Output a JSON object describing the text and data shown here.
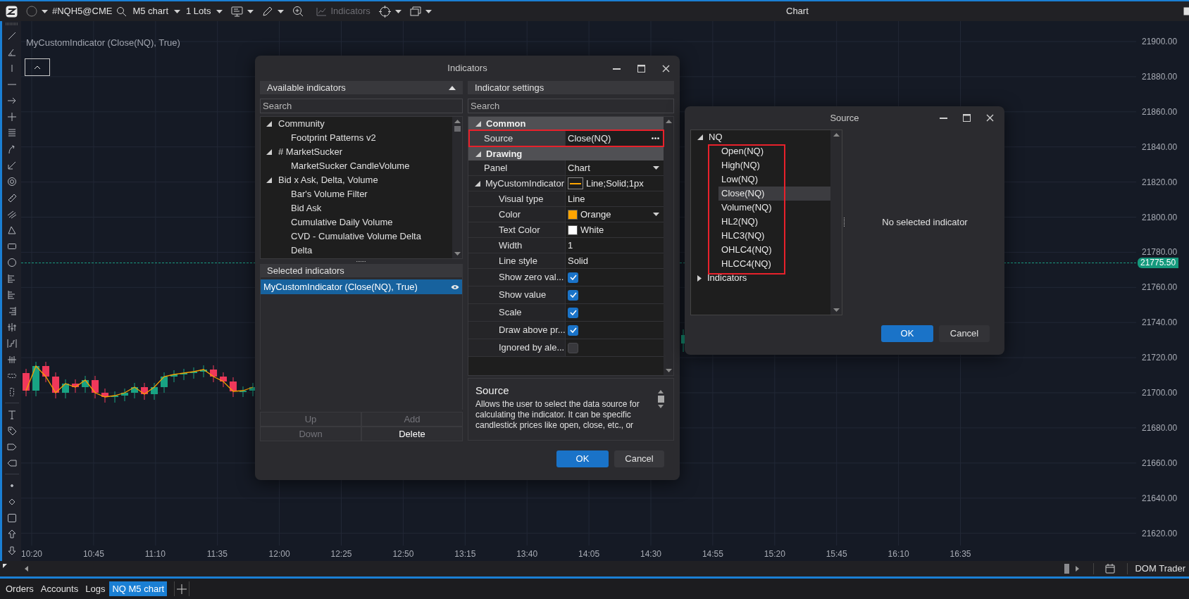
{
  "toolbar": {
    "symbol": "#NQH5@CME",
    "chart_type": "M5 chart",
    "lots": "1 Lots",
    "indicators": {
      "label": "Indicators",
      "disabled": true
    }
  },
  "window_title": "Chart",
  "chart": {
    "legend": "MyCustomIndicator (Close(NQ), True)",
    "price_labels": [
      "21900.00",
      "21880.00",
      "21860.00",
      "21840.00",
      "21820.00",
      "21800.00",
      "21780.00",
      "21760.00",
      "21740.00",
      "21720.00",
      "21700.00",
      "21680.00",
      "21660.00",
      "21640.00",
      "21620.00"
    ],
    "current_price": "21775.50",
    "time_labels": [
      "10:20",
      "10:45",
      "11:10",
      "11:35",
      "12:00",
      "12:25",
      "12:50",
      "13:15",
      "13:40",
      "14:05",
      "14:30",
      "14:55",
      "15:20",
      "15:45",
      "16:10",
      "16:35"
    ]
  },
  "indicators_dialog": {
    "title": "Indicators",
    "available": {
      "header": "Available indicators",
      "search_placeholder": "Search",
      "tree": [
        {
          "label": "Community",
          "expanded": true,
          "children": [
            {
              "label": "Footprint Patterns v2"
            }
          ]
        },
        {
          "label": "# MarketSucker",
          "expanded": true,
          "children": [
            {
              "label": "MarketSucker CandleVolume"
            }
          ]
        },
        {
          "label": "Bid x Ask, Delta, Volume",
          "expanded": true,
          "children": [
            {
              "label": "Bar's Volume Filter"
            },
            {
              "label": "Bid Ask"
            },
            {
              "label": "Cumulative Daily Volume"
            },
            {
              "label": "CVD - Cumulative Volume Delta"
            },
            {
              "label": "Delta"
            }
          ]
        }
      ]
    },
    "selected": {
      "header": "Selected indicators",
      "items": [
        {
          "label": "MyCustomIndicator (Close(NQ), True)",
          "selected": true
        }
      ]
    },
    "list_buttons": [
      {
        "label": "Up",
        "disabled": true
      },
      {
        "label": "Add",
        "disabled": true
      },
      {
        "label": "Down",
        "disabled": true
      },
      {
        "label": "Delete",
        "disabled": false
      }
    ],
    "settings": {
      "header": "Indicator settings",
      "search_placeholder": "Search",
      "categories": [
        {
          "label": "Common",
          "expanded": true,
          "properties": [
            {
              "name": "Source",
              "kind": "ellipsis",
              "value": "Close(NQ)",
              "highlighted": true
            }
          ]
        },
        {
          "label": "Drawing",
          "expanded": true,
          "properties": [
            {
              "name": "Panel",
              "kind": "dropdown",
              "value": "Chart"
            },
            {
              "name": "MyCustomIndicator",
              "kind": "line",
              "value": "Line;Solid;1px",
              "color": "#ffa500",
              "expanded": true,
              "children": [
                {
                  "name": "Visual type",
                  "kind": "text",
                  "value": "Line"
                },
                {
                  "name": "Color",
                  "kind": "color-dropdown",
                  "value": "Orange",
                  "color": "#ffa500"
                },
                {
                  "name": "Text Color",
                  "kind": "color",
                  "value": "White",
                  "color": "#ffffff"
                },
                {
                  "name": "Width",
                  "kind": "text",
                  "value": "1"
                },
                {
                  "name": "Line style",
                  "kind": "text",
                  "value": "Solid"
                },
                {
                  "name": "Show zero val...",
                  "kind": "checkbox",
                  "checked": true
                },
                {
                  "name": "Show value",
                  "kind": "checkbox",
                  "checked": true
                },
                {
                  "name": "Scale",
                  "kind": "checkbox",
                  "checked": true
                },
                {
                  "name": "Draw above pr...",
                  "kind": "checkbox",
                  "checked": true
                },
                {
                  "name": "Ignored by ale...",
                  "kind": "checkbox",
                  "checked": false
                }
              ]
            }
          ]
        }
      ]
    },
    "description": {
      "title": "Source",
      "text": "Allows the user to select the data source for calculating the indicator. It can be specific candlestick prices like open, close, etc., or"
    },
    "ok": "OK",
    "cancel": "Cancel"
  },
  "source_dialog": {
    "title": "Source",
    "tree": [
      {
        "label": "NQ",
        "expanded": true,
        "highlighted": true,
        "children": [
          {
            "label": "Open(NQ)",
            "selected": false
          },
          {
            "label": "High(NQ)",
            "selected": false
          },
          {
            "label": "Low(NQ)",
            "selected": false
          },
          {
            "label": "Close(NQ)",
            "selected": true
          },
          {
            "label": "Volume(NQ)",
            "selected": false
          },
          {
            "label": "HL2(NQ)",
            "selected": false
          },
          {
            "label": "HLC3(NQ)",
            "selected": false
          },
          {
            "label": "OHLC4(NQ)",
            "selected": false
          },
          {
            "label": "HLCC4(NQ)",
            "selected": false
          }
        ]
      },
      {
        "label": "Indicators",
        "expanded": false
      }
    ],
    "empty_message": "No selected indicator",
    "ok": "OK",
    "cancel": "Cancel"
  },
  "bottom_tabs": [
    {
      "label": "Orders",
      "selected": false
    },
    {
      "label": "Accounts",
      "selected": false
    },
    {
      "label": "Logs",
      "selected": false
    },
    {
      "label": "NQ M5 chart",
      "selected": true
    }
  ],
  "dom_trader": "DOM Trader"
}
